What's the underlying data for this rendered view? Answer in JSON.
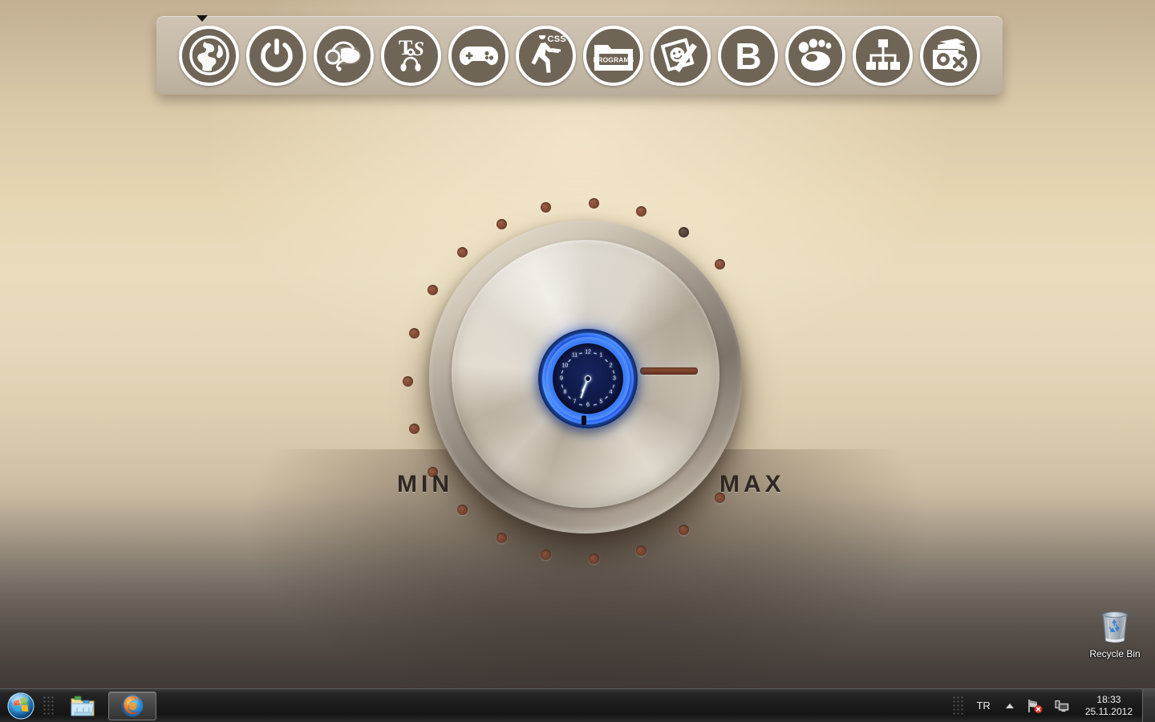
{
  "desktop": {
    "wallpaper_name": "audio-knob-wallpaper",
    "knob": {
      "min_label": "MIN",
      "max_label": "MAX",
      "indicator_color": "#7b4229",
      "dot_color": "#8a4f39",
      "metal_color": "#cfc6b6"
    },
    "clock_widget": {
      "name": "neon-clock-gadget",
      "numbers": [
        "12",
        "1",
        "2",
        "3",
        "4",
        "5",
        "6",
        "7",
        "8",
        "9",
        "10",
        "11"
      ],
      "neon_color": "#2a76ff",
      "face_color": "#101a4a",
      "hour_hand_deg": 205,
      "minute_hand_deg": 200
    },
    "icons": [
      {
        "name": "recycle-bin",
        "label": "Recycle Bin"
      }
    ]
  },
  "dock": {
    "name": "objectdock-toolbar",
    "background_color": "#c8bcab",
    "circle_color": "#6f6557",
    "items": [
      {
        "icon": "globe-icon",
        "label": "Internet"
      },
      {
        "icon": "power-icon",
        "label": "Shutdown"
      },
      {
        "icon": "headset-icon",
        "label": "Voice Chat"
      },
      {
        "icon": "teamspeak-icon",
        "label": "TeamSpeak"
      },
      {
        "icon": "gamepad-icon",
        "label": "Games"
      },
      {
        "icon": "counter-strike-icon",
        "label": "CSS",
        "badge": "CSS"
      },
      {
        "icon": "folder-icon",
        "label": "PROGRAMS",
        "glyph_text": "PROGRAMS"
      },
      {
        "icon": "paint-icon",
        "label": "Paint"
      },
      {
        "icon": "letter-b-icon",
        "label": "B",
        "glyph_text": "B"
      },
      {
        "icon": "paw-icon",
        "label": "Baidu"
      },
      {
        "icon": "network-icon",
        "label": "Network"
      },
      {
        "icon": "camera-delete-icon",
        "label": "Remove Camera"
      }
    ]
  },
  "taskbar": {
    "start_button": "start-orb",
    "buttons": [
      {
        "name": "explorer-button",
        "icon": "folder-icon",
        "active": false
      },
      {
        "name": "firefox-button",
        "icon": "firefox-icon",
        "active": true
      }
    ],
    "tray": {
      "language": "TR",
      "show_hidden_icons": "chevron-up-icon",
      "icons": [
        {
          "name": "network-error-icon"
        },
        {
          "name": "display-icon"
        }
      ],
      "time": "18:33",
      "date": "25.11.2012",
      "show_desktop": "show-desktop-button"
    }
  }
}
